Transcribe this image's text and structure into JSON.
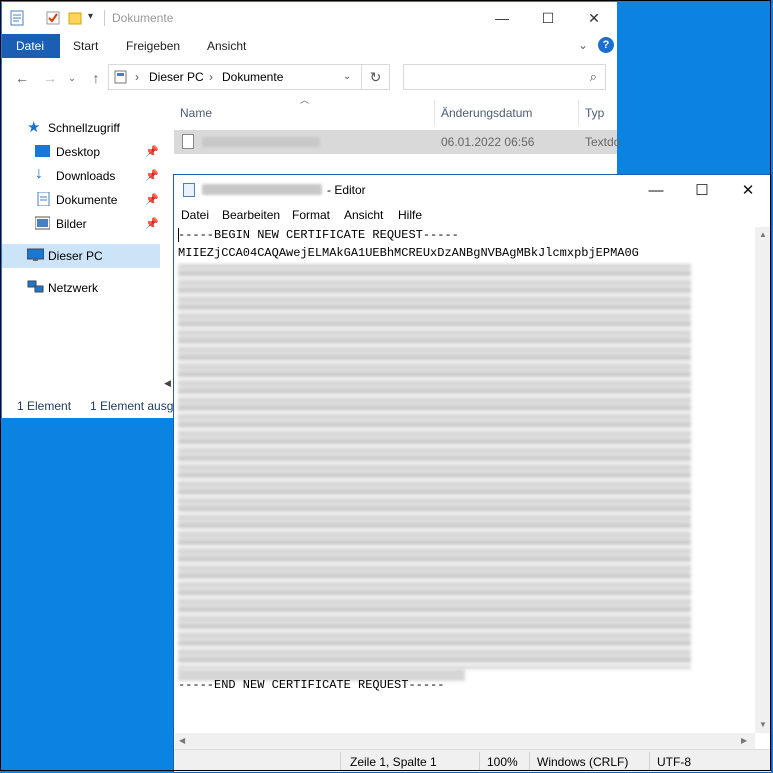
{
  "explorer": {
    "title": "Dokumente",
    "ribbon_tabs": [
      "Datei",
      "Start",
      "Freigeben",
      "Ansicht"
    ],
    "address": {
      "root": "Dieser PC",
      "folder": "Dokumente"
    },
    "search": {
      "placeholder": ""
    },
    "nav": {
      "quick_access": "Schnellzugriff",
      "items": [
        "Desktop",
        "Downloads",
        "Dokumente",
        "Bilder"
      ],
      "this_pc": "Dieser PC",
      "network": "Netzwerk"
    },
    "columns": {
      "name": "Name",
      "modified": "Änderungsdatum",
      "type": "Typ"
    },
    "file": {
      "date": "06.01.2022 06:56",
      "type": "Textdo"
    },
    "status": {
      "count": "1 Element",
      "selected": "1 Element ausge"
    }
  },
  "notepad": {
    "title": "- Editor",
    "menu": [
      "Datei",
      "Bearbeiten",
      "Format",
      "Ansicht",
      "Hilfe"
    ],
    "text": {
      "begin": "-----BEGIN NEW CERTIFICATE REQUEST-----",
      "first_line": "MIIEZjCCA04CAQAwejELMAkGA1UEBhMCREUxDzANBgNVBAgMBkJlcmxpbjEPMA0G",
      "end": "-----END NEW CERTIFICATE REQUEST-----"
    },
    "status": {
      "position": "Zeile 1, Spalte 1",
      "zoom": "100%",
      "line_endings": "Windows (CRLF)",
      "encoding": "UTF-8"
    }
  }
}
